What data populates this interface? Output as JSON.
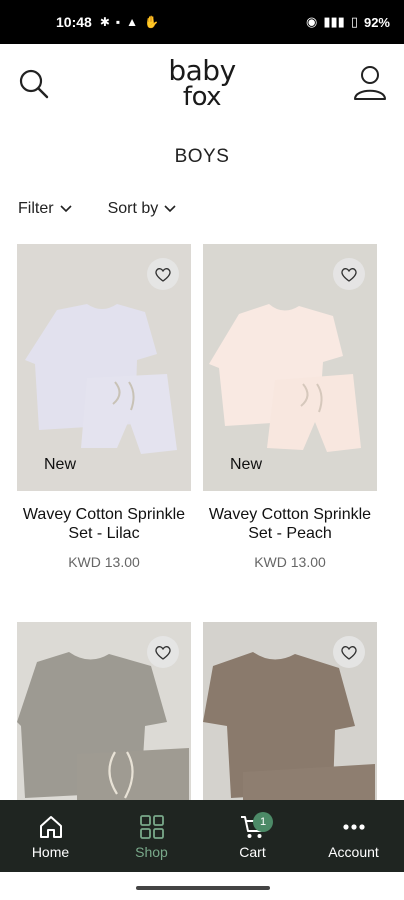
{
  "status": {
    "time": "10:48",
    "battery": "92%"
  },
  "header": {
    "logo_line1": "baby",
    "logo_line2": "fox"
  },
  "page": {
    "title": "BOYS"
  },
  "filters": {
    "filter_label": "Filter",
    "sort_label": "Sort by"
  },
  "products": [
    {
      "name": "Wavey Cotton Sprinkle Set - Lilac",
      "price": "KWD 13.00",
      "badge": "New",
      "bg": "#dcd9d4",
      "shirt": "#e2e1ee",
      "short": "#e4e3ef"
    },
    {
      "name": "Wavey Cotton Sprinkle Set - Peach",
      "price": "KWD 13.00",
      "badge": "New",
      "bg": "#d9d7d1",
      "shirt": "#f9e9e2",
      "short": "#f8e7df"
    },
    {
      "name": "",
      "price": "",
      "badge": "",
      "bg": "#dcdad5",
      "shirt": "#9d9a92",
      "short": "#9f9b92"
    },
    {
      "name": "",
      "price": "",
      "badge": "",
      "bg": "#d4d2cd",
      "shirt": "#8a7a6c",
      "short": "#8e7e70"
    }
  ],
  "nav": {
    "home": "Home",
    "shop": "Shop",
    "cart": "Cart",
    "cart_count": "1",
    "account": "Account"
  },
  "colors": {
    "nav_bg": "#1f2521",
    "nav_active": "#79a98a",
    "badge_bg": "#4c8a67"
  }
}
